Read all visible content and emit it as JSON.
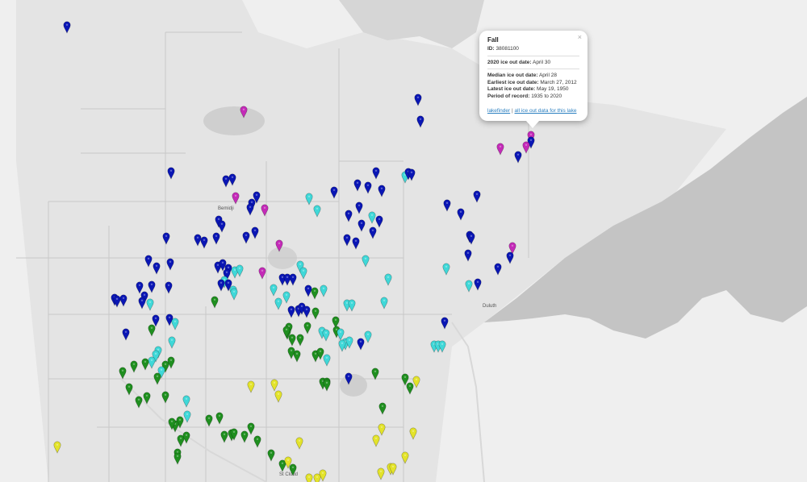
{
  "map": {
    "labels": {
      "bemidji": "Bemidji",
      "duluth": "Duluth",
      "st_cloud": "St Cloud"
    },
    "marker_colors": {
      "dark_blue": "#0a16b5",
      "magenta": "#c42ab8",
      "cyan": "#3fd8d8",
      "green": "#1f8f1f",
      "yellow": "#e3e32a"
    },
    "land_color": "#e9e9e9",
    "water_color": "#c9c9c9",
    "lake_superior_color": "#c4c4c4"
  },
  "popup": {
    "lake_name": "Fall",
    "id_label": "ID:",
    "id_value": "38081100",
    "ice_out_2020_label": "2020 ice out date:",
    "ice_out_2020_value": "April 30",
    "median_label": "Median ice out date:",
    "median_value": "April 28",
    "earliest_label": "Earliest ice out date:",
    "earliest_value": "March 27, 2012",
    "latest_label": "Latest ice out date:",
    "latest_value": "May 19, 1950",
    "period_label": "Period of record:",
    "period_value": "1935 to 2020",
    "lakefinder_link": "lakefinder",
    "separator": "|",
    "all_data_link": "all ice out data for this lake",
    "close_symbol": "×"
  }
}
